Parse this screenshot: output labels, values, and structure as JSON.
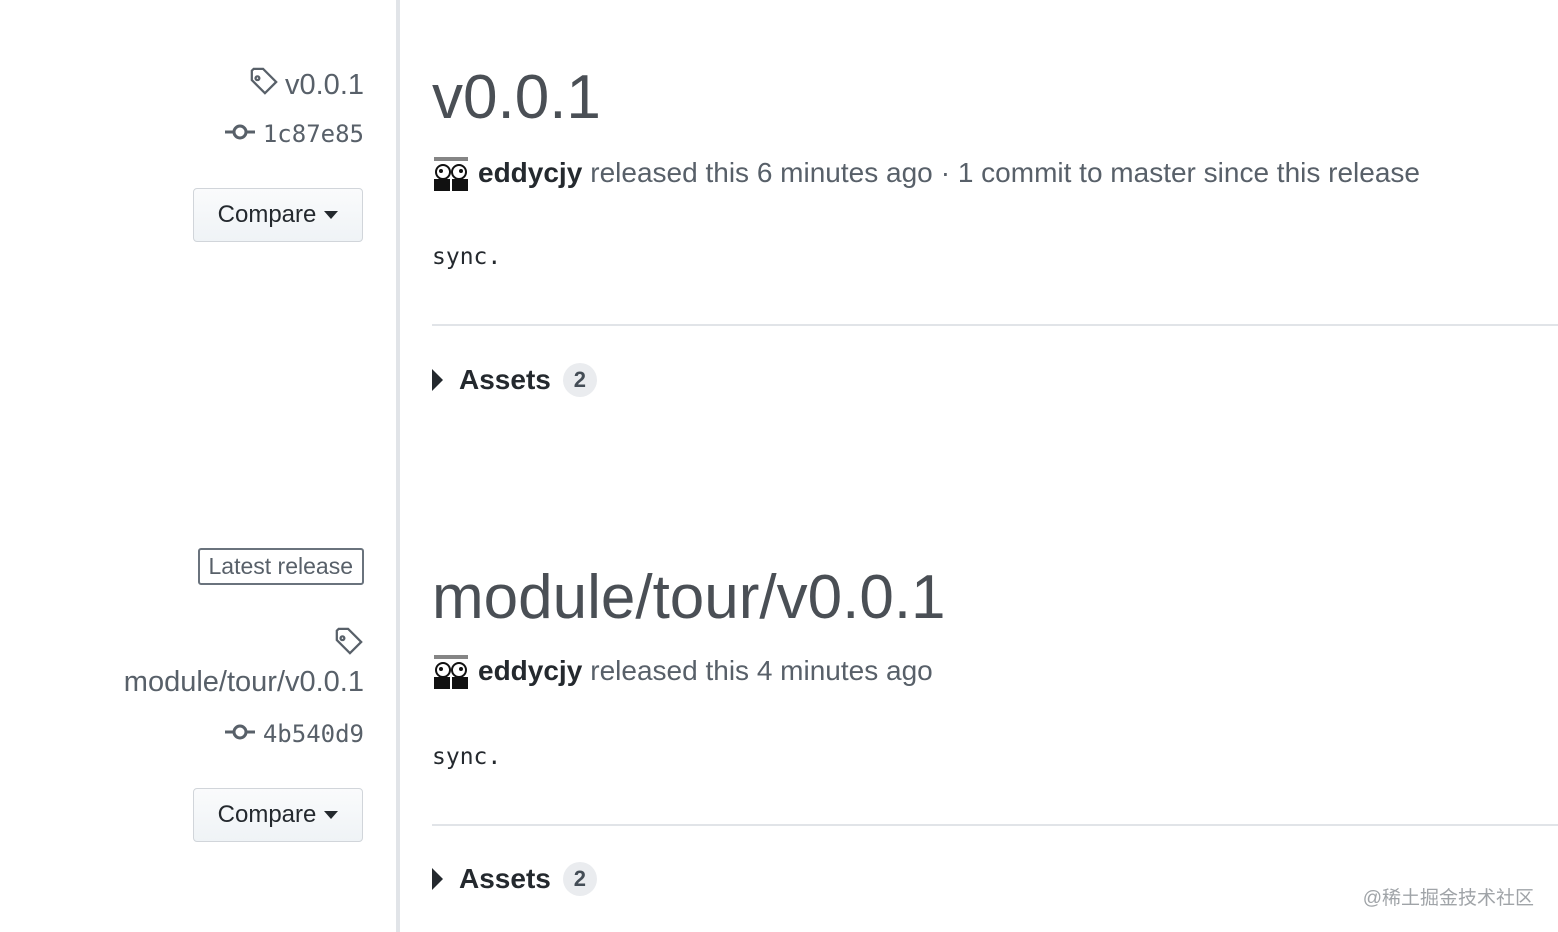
{
  "releases": [
    {
      "tag": "v0.0.1",
      "commit": "1c87e85",
      "compare_label": "Compare",
      "title": "v0.0.1",
      "author": "eddycjy",
      "released_text": "released this 6 minutes ago",
      "since_text": "· 1 commit to master since this release",
      "body": "sync.",
      "assets_label": "Assets",
      "assets_count": "2"
    },
    {
      "latest_label": "Latest release",
      "tag": "module/tour/v0.0.1",
      "commit": "4b540d9",
      "compare_label": "Compare",
      "title": "module/tour/v0.0.1",
      "author": "eddycjy",
      "released_text": "released this 4 minutes ago",
      "body": "sync.",
      "assets_label": "Assets",
      "assets_count": "2"
    }
  ],
  "watermark": "@稀土掘金技术社区",
  "colors": {
    "text": "#24292e",
    "muted": "#586069",
    "border": "#e1e4e8",
    "badge": "#eaecef"
  }
}
